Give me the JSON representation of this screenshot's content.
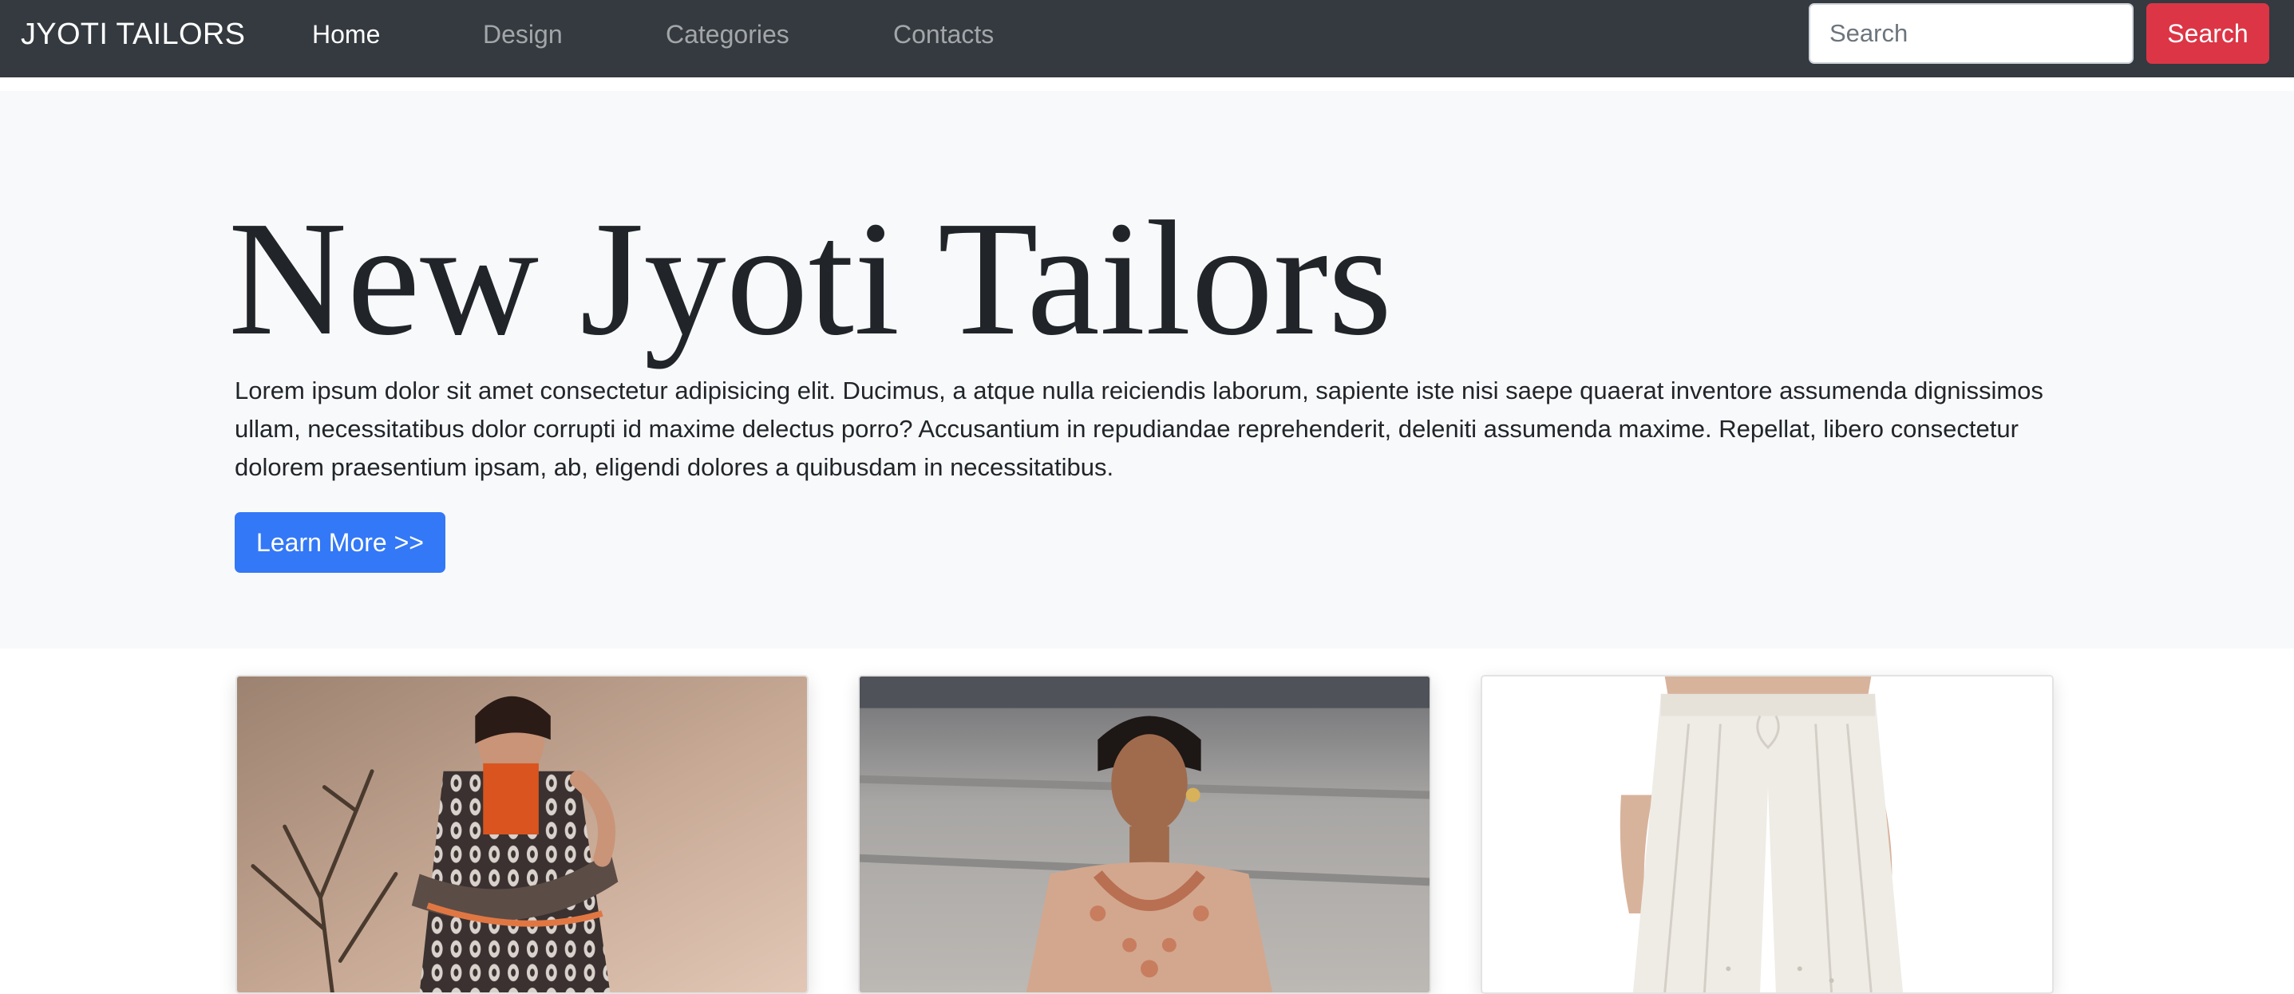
{
  "navbar": {
    "brand": "JYOTI TAILORS",
    "links": [
      {
        "label": "Home",
        "active": true
      },
      {
        "label": "Design",
        "active": false
      },
      {
        "label": "Categories",
        "active": false
      },
      {
        "label": "Contacts",
        "active": false
      }
    ],
    "search": {
      "placeholder": "Search",
      "value": "",
      "button_label": "Search"
    }
  },
  "hero": {
    "title": "New Jyoti Tailors",
    "text": "Lorem ipsum dolor sit amet consectetur adipisicing elit. Ducimus, a atque nulla reiciendis laborum, sapiente iste nisi saepe quaerat inventore assumenda dignissimos ullam, necessitatibus dolor corrupti id maxime delectus porro? Accusantium in repudiandae reprehenderit, deleniti assumenda maxime. Repellat, libero consectetur dolorem praesentium ipsam, ab, eligendi dolores a quibusdam in necessitatibus.",
    "button_label": "Learn More >>"
  },
  "cards": [
    {
      "image": "woman-in-printed-salwar-suit-photo"
    },
    {
      "image": "woman-in-embroidered-peach-dress-photo"
    },
    {
      "image": "white-palazzo-pants-photo"
    }
  ],
  "colors": {
    "navbar_bg": "#343a40",
    "jumbotron_bg": "#f8f9fa",
    "primary": "#3378f6",
    "danger": "#dc3545"
  }
}
